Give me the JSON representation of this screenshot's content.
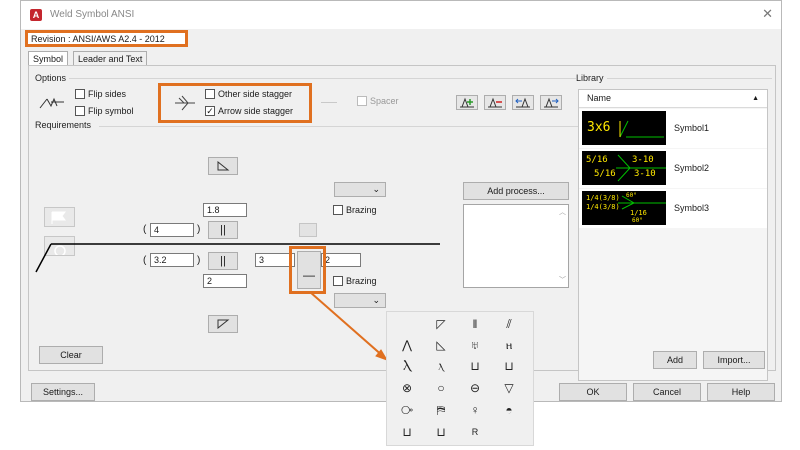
{
  "window": {
    "title": "Weld Symbol ANSI",
    "app_icon_letter": "A",
    "close_glyph": "✕",
    "revision": "Revision : ANSI/AWS A2.4 - 2012"
  },
  "tabs": [
    {
      "label": "Symbol",
      "active": true
    },
    {
      "label": "Leader and Text",
      "active": false
    }
  ],
  "options": {
    "group_label": "Options",
    "flip_sides": {
      "label": "Flip sides",
      "checked": false
    },
    "flip_symbol": {
      "label": "Flip symbol",
      "checked": false
    },
    "other_side_stagger": {
      "label": "Other side stagger",
      "checked": false
    },
    "arrow_side_stagger": {
      "label": "Arrow side stagger",
      "checked": true
    },
    "spacer": {
      "label": "Spacer",
      "checked": false,
      "enabled": false
    },
    "toolbar_icons": [
      "add-symbol-icon",
      "remove-symbol-icon",
      "move-left-icon",
      "move-right-icon"
    ]
  },
  "requirements": {
    "group_label": "Requirements",
    "top_value_field": "1.8",
    "other_side_size": "4",
    "arrow_side_size": "3.2",
    "arrow_side_length": "3",
    "other_side_pitch": "",
    "arrow_side_pitch": "2",
    "brazing_top": {
      "label": "Brazing",
      "checked": false
    },
    "brazing_bottom": {
      "label": "Brazing",
      "checked": false
    },
    "paren_open": "(",
    "paren_close": ")",
    "suffix_char": "2",
    "add_process_label": "Add process...",
    "clear_label": "Clear",
    "dropdown_chevron": "⌄"
  },
  "library": {
    "group_label": "Library",
    "column_header": "Name",
    "sort_glyph": "▲",
    "items": [
      {
        "name": "Symbol1",
        "thumb_text": "3x6"
      },
      {
        "name": "Symbol2",
        "thumb_line1": "5/16",
        "thumb_line2": "5/16",
        "thumb_right1": "3-10",
        "thumb_right2": "3-10"
      },
      {
        "name": "Symbol3",
        "thumb_line1": "1/4(3/8)",
        "thumb_line2": "1/4(3/8)",
        "thumb_right": "1/16",
        "thumb_bottom": "60°",
        "thumb_sup": "60°"
      }
    ],
    "add_label": "Add",
    "import_label": "Import..."
  },
  "footer": {
    "settings_label": "Settings...",
    "ok_label": "OK",
    "cancel_label": "Cancel",
    "help_label": "Help"
  },
  "palette": {
    "glyphs": [
      [
        "",
        "◸",
        "‖",
        "⫽"
      ],
      [
        "⋀",
        "◺",
        "♅",
        "ⲏ"
      ],
      [
        "Ⲗ",
        "ⲗ",
        "⊔",
        "⊔"
      ],
      [
        "⊗",
        "○",
        "⊖",
        "▽"
      ],
      [
        "⧂",
        "⛿",
        "♀",
        "◓"
      ],
      [
        "⊔",
        "⊔",
        "R"
      ]
    ]
  },
  "colors": {
    "highlight": "#e07020",
    "thumb_text": "#ffe800",
    "thumb_line": "#00c000",
    "dialog_bg": "#f0f0f0"
  }
}
